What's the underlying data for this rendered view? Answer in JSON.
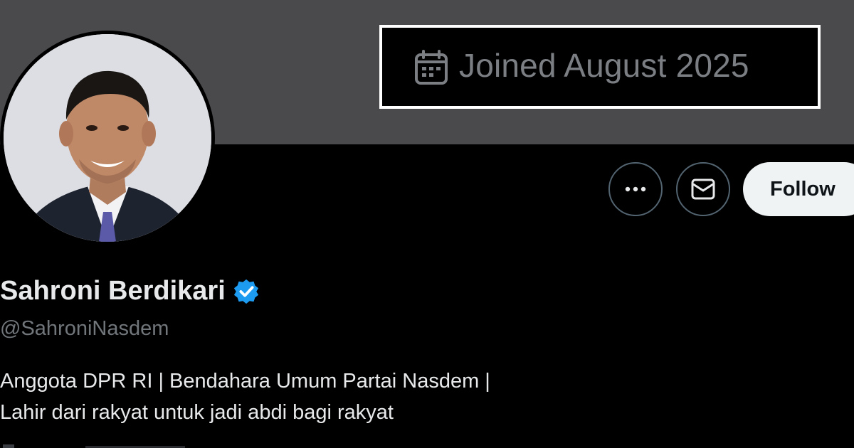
{
  "banner": {
    "color": "#4a4a4d",
    "joined_icon": "calendar-icon",
    "joined_text": "Joined August 2025"
  },
  "profile": {
    "display_name": "Sahroni Berdikari",
    "verified_icon": "verified-badge-icon",
    "verified_color": "#1d9bf0",
    "handle": "@SahroniNasdem",
    "bio_lines": [
      "Anggota DPR RI | Bendahara Umum Partai Nasdem |",
      "Lahir dari rakyat untuk jadi abdi bagi rakyat"
    ]
  },
  "actions": {
    "more_icon": "more-dots-icon",
    "message_icon": "envelope-icon",
    "follow_label": "Follow"
  }
}
